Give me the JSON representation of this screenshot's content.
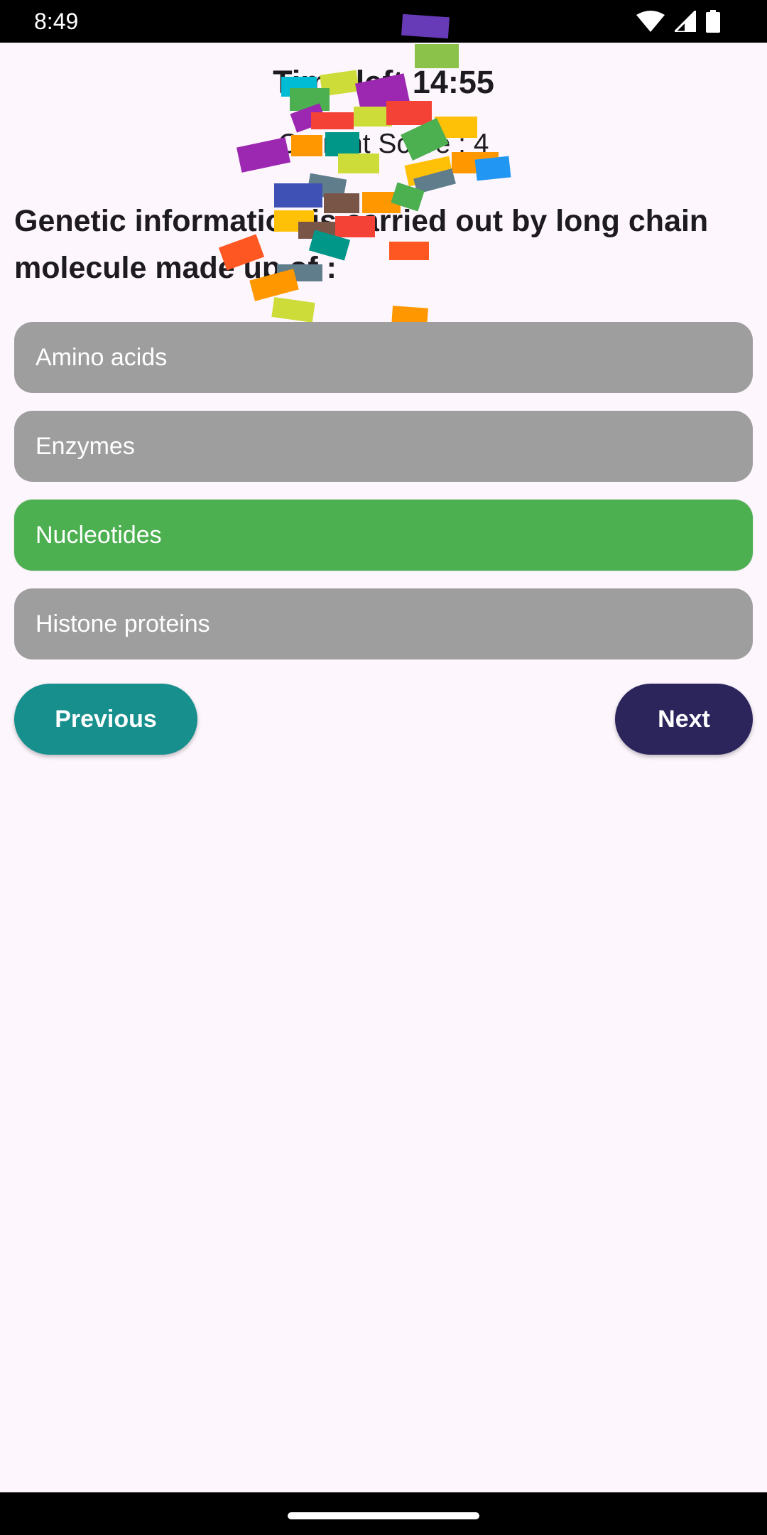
{
  "status_bar": {
    "time": "8:49",
    "icons": [
      "wifi-icon",
      "signal-icon",
      "battery-icon"
    ]
  },
  "quiz": {
    "timer_text": "Time left 14:55",
    "score_text": "Current Score : 4",
    "question": "Genetic information is carried out by long chain molecule made up of :",
    "options": [
      {
        "label": "Amino acids",
        "state": "default"
      },
      {
        "label": "Enzymes",
        "state": "default"
      },
      {
        "label": "Nucleotides",
        "state": "correct"
      },
      {
        "label": "Histone proteins",
        "state": "default"
      }
    ]
  },
  "buttons": {
    "previous": "Previous",
    "next": "Next"
  },
  "colors": {
    "background": "#fdf6fd",
    "option_default": "#9e9e9e",
    "option_correct": "#4caf50",
    "previous_button": "#178f8c",
    "next_button": "#2b255c"
  }
}
